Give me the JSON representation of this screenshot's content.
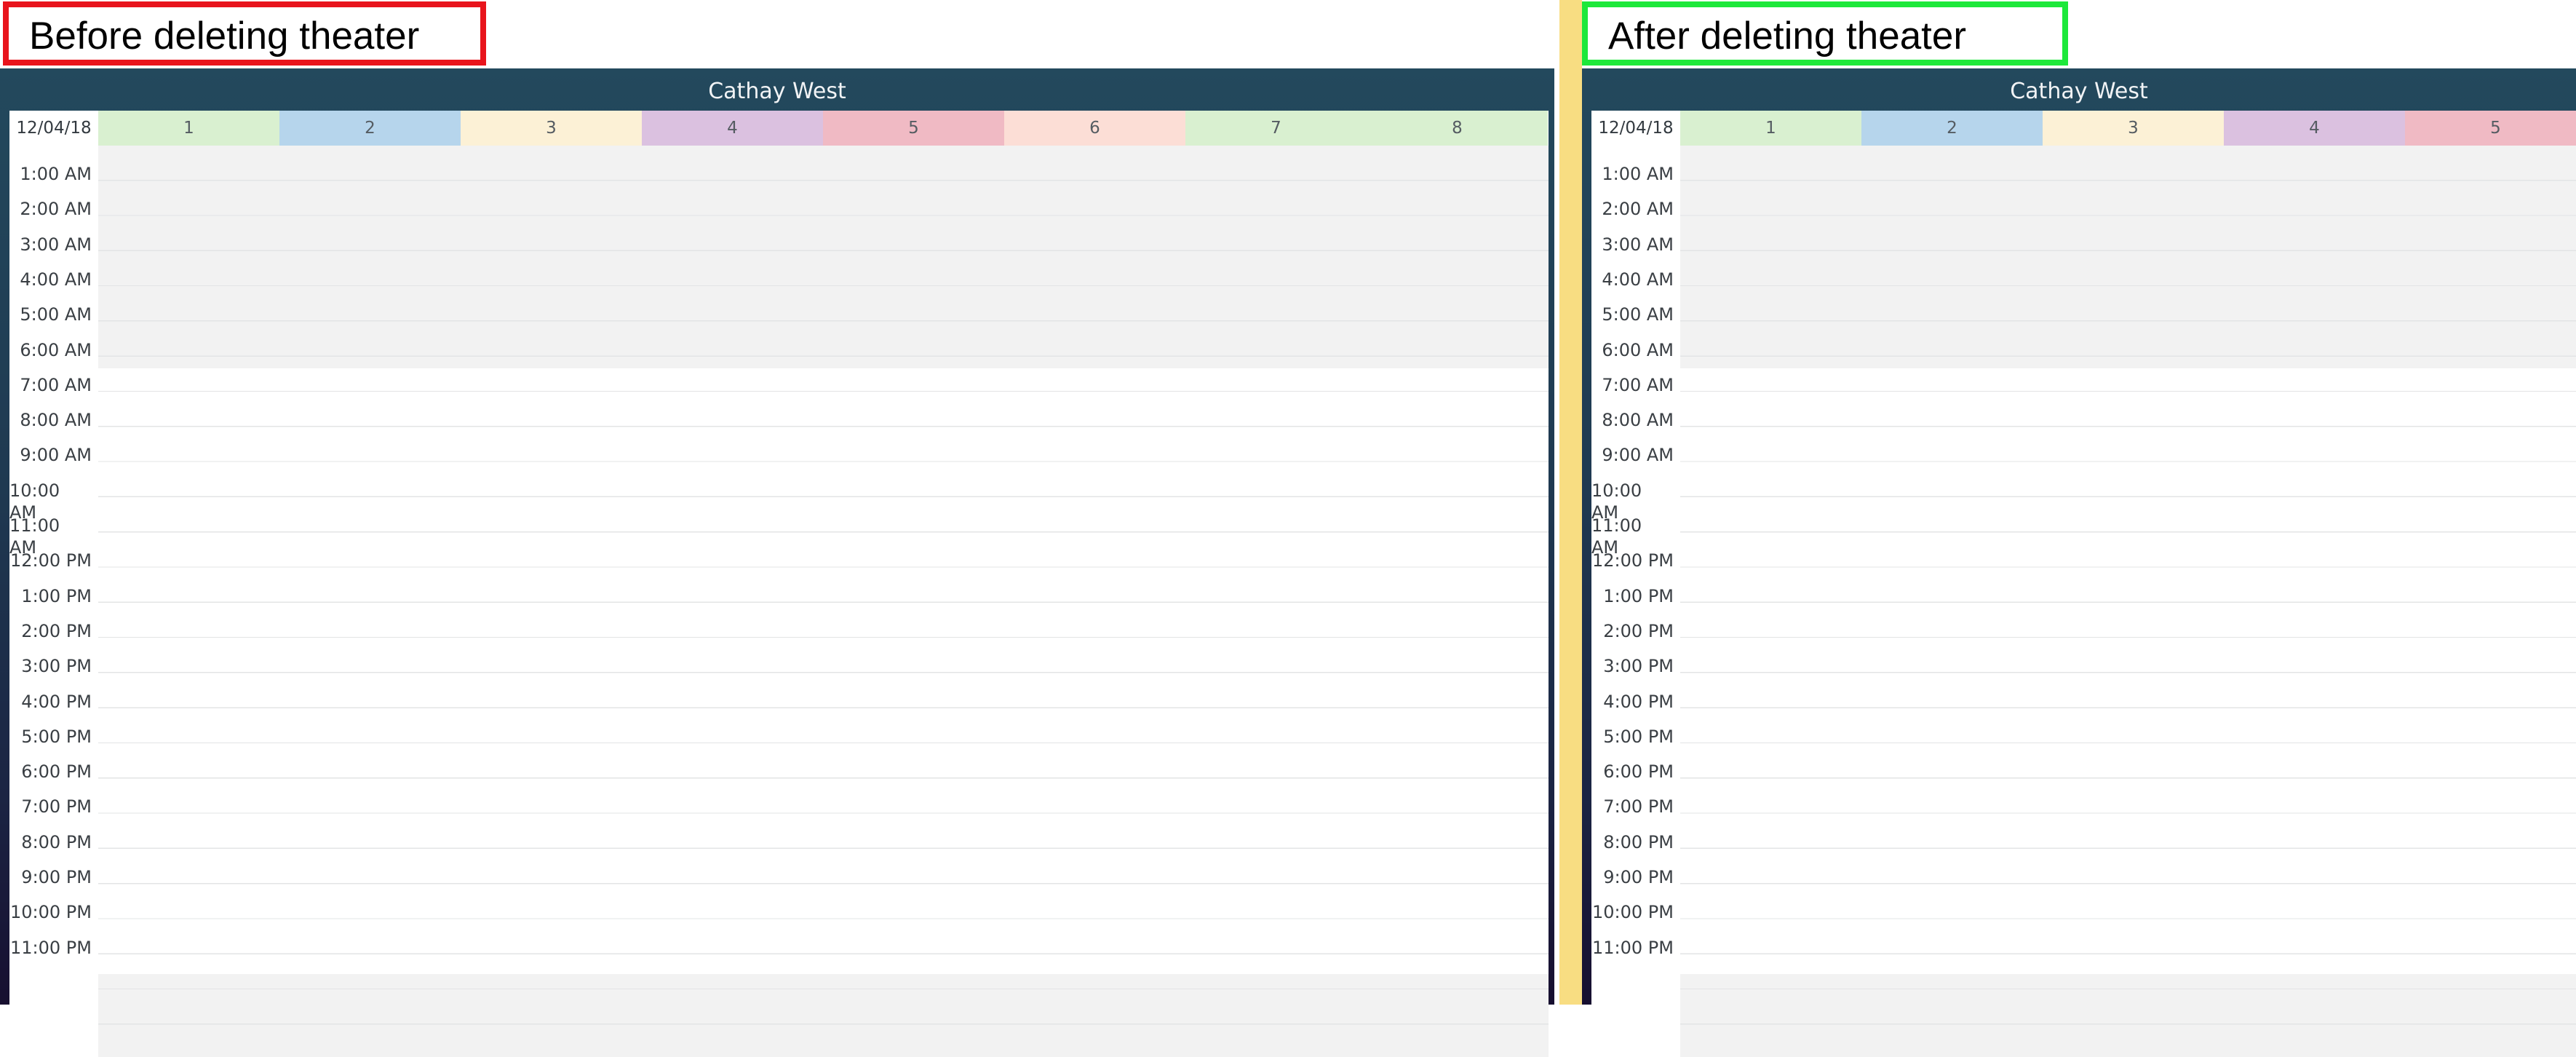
{
  "captions": {
    "before": "Before deleting theater",
    "after": "After deleting theater"
  },
  "colors": {
    "caption_before_border": "#e8141c",
    "caption_after_border": "#1de83a",
    "divider": "#f8dd82",
    "panel_top": "#23495d",
    "panel_bottom": "#170f30"
  },
  "before": {
    "venue": "Cathay West",
    "date": "12/04/18",
    "theaters": [
      {
        "label": "1",
        "color": "#d9f0d0"
      },
      {
        "label": "2",
        "color": "#b6d5ec"
      },
      {
        "label": "3",
        "color": "#fcf1d6"
      },
      {
        "label": "4",
        "color": "#dbc1e0"
      },
      {
        "label": "5",
        "color": "#f0bac4"
      },
      {
        "label": "6",
        "color": "#fcded6"
      },
      {
        "label": "7",
        "color": "#d9f0d0"
      },
      {
        "label": "8",
        "color": "#d9f0d0"
      }
    ]
  },
  "after": {
    "venue": "Cathay West",
    "date": "12/04/18",
    "theaters": [
      {
        "label": "1",
        "color": "#d9f0d0"
      },
      {
        "label": "2",
        "color": "#b6d5ec"
      },
      {
        "label": "3",
        "color": "#fcf1d6"
      },
      {
        "label": "4",
        "color": "#dbc1e0"
      },
      {
        "label": "5",
        "color": "#f0bac4"
      }
    ]
  },
  "hours": [
    "1:00 AM",
    "2:00 AM",
    "3:00 AM",
    "4:00 AM",
    "5:00 AM",
    "6:00 AM",
    "7:00 AM",
    "8:00 AM",
    "9:00 AM",
    "10:00 AM",
    "11:00 AM",
    "12:00 PM",
    "1:00 PM",
    "2:00 PM",
    "3:00 PM",
    "4:00 PM",
    "5:00 PM",
    "6:00 PM",
    "7:00 PM",
    "8:00 PM",
    "9:00 PM",
    "10:00 PM",
    "11:00 PM"
  ]
}
